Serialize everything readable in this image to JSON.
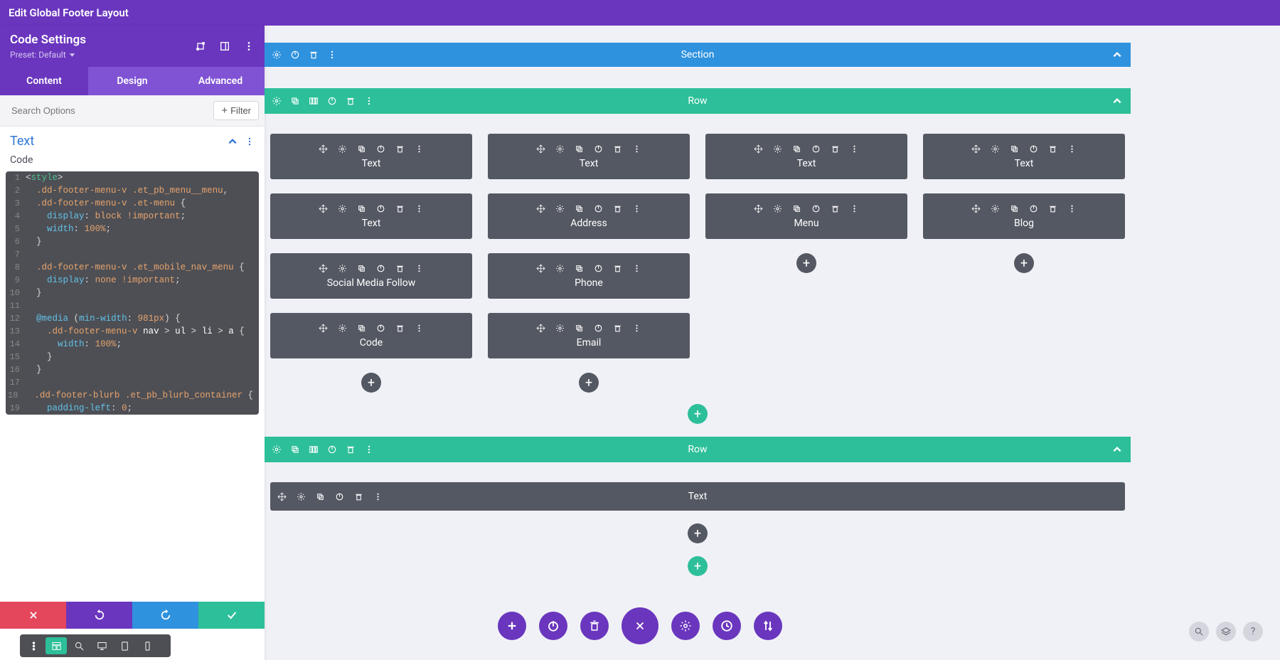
{
  "topBar": {
    "title": "Edit Global Footer Layout"
  },
  "sidebar": {
    "title": "Code Settings",
    "preset": "Preset: Default",
    "tabs": [
      "Content",
      "Design",
      "Advanced"
    ],
    "activeTab": 0,
    "searchPlaceholder": "Search Options",
    "filterLabel": "Filter",
    "sectionTitle": "Text",
    "subsectionLabel": "Code",
    "code": {
      "lines": [
        {
          "n": 1,
          "html": "<span class='c-punc'>&lt;</span><span class='c-tag'>style</span><span class='c-punc'>&gt;</span>"
        },
        {
          "n": 2,
          "html": "  <span class='c-class'>.dd-footer-menu-v</span> <span class='c-class'>.et_pb_menu__menu</span><span class='c-punc'>,</span>"
        },
        {
          "n": 3,
          "html": "  <span class='c-class'>.dd-footer-menu-v</span> <span class='c-class'>.et-menu</span> <span class='c-punc'>{</span>"
        },
        {
          "n": 4,
          "html": "    <span class='c-prop'>display</span><span class='c-punc'>:</span> <span class='c-val'>block</span> <span class='c-imp'>!important</span><span class='c-punc'>;</span>"
        },
        {
          "n": 5,
          "html": "    <span class='c-prop'>width</span><span class='c-punc'>:</span> <span class='c-num'>100%</span><span class='c-punc'>;</span>"
        },
        {
          "n": 6,
          "html": "  <span class='c-punc'>}</span>"
        },
        {
          "n": 7,
          "html": ""
        },
        {
          "n": 8,
          "html": "  <span class='c-class'>.dd-footer-menu-v</span> <span class='c-class'>.et_mobile_nav_menu</span> <span class='c-punc'>{</span>"
        },
        {
          "n": 9,
          "html": "    <span class='c-prop'>display</span><span class='c-punc'>:</span> <span class='c-val'>none</span> <span class='c-imp'>!important</span><span class='c-punc'>;</span>"
        },
        {
          "n": 10,
          "html": "  <span class='c-punc'>}</span>"
        },
        {
          "n": 11,
          "html": ""
        },
        {
          "n": 12,
          "html": "  <span class='c-at'>@media</span> <span class='c-punc'>(</span><span class='c-prop'>min-width</span><span class='c-punc'>:</span> <span class='c-num'>981px</span><span class='c-punc'>)</span> <span class='c-punc'>{</span>"
        },
        {
          "n": 13,
          "html": "    <span class='c-class'>.dd-footer-menu-v</span> <span class='c-sel'>nav</span> <span class='c-punc'>&gt;</span> <span class='c-sel'>ul</span> <span class='c-punc'>&gt;</span> <span class='c-sel'>li</span> <span class='c-punc'>&gt;</span> <span class='c-sel'>a</span> <span class='c-punc'>{</span>"
        },
        {
          "n": 14,
          "html": "      <span class='c-prop'>width</span><span class='c-punc'>:</span> <span class='c-num'>100%</span><span class='c-punc'>;</span>"
        },
        {
          "n": 15,
          "html": "    <span class='c-punc'>}</span>"
        },
        {
          "n": 16,
          "html": "  <span class='c-punc'>}</span>"
        },
        {
          "n": 17,
          "html": ""
        },
        {
          "n": 18,
          "html": "  <span class='c-class'>.dd-footer-blurb</span> <span class='c-class'>.et_pb_blurb_container</span> <span class='c-punc'>{</span>"
        },
        {
          "n": 19,
          "html": "    <span class='c-prop'>padding-left</span><span class='c-punc'>:</span> <span class='c-num'>0</span><span class='c-punc'>;</span>"
        }
      ]
    }
  },
  "canvas": {
    "sectionLabel": "Section",
    "row1Label": "Row",
    "row2Label": "Row",
    "columns": [
      [
        "Text",
        "Text",
        "Social Media Follow",
        "Code"
      ],
      [
        "Text",
        "Address",
        "Phone",
        "Email"
      ],
      [
        "Text",
        "Menu"
      ],
      [
        "Text",
        "Blog"
      ]
    ],
    "row2Module": "Text"
  }
}
